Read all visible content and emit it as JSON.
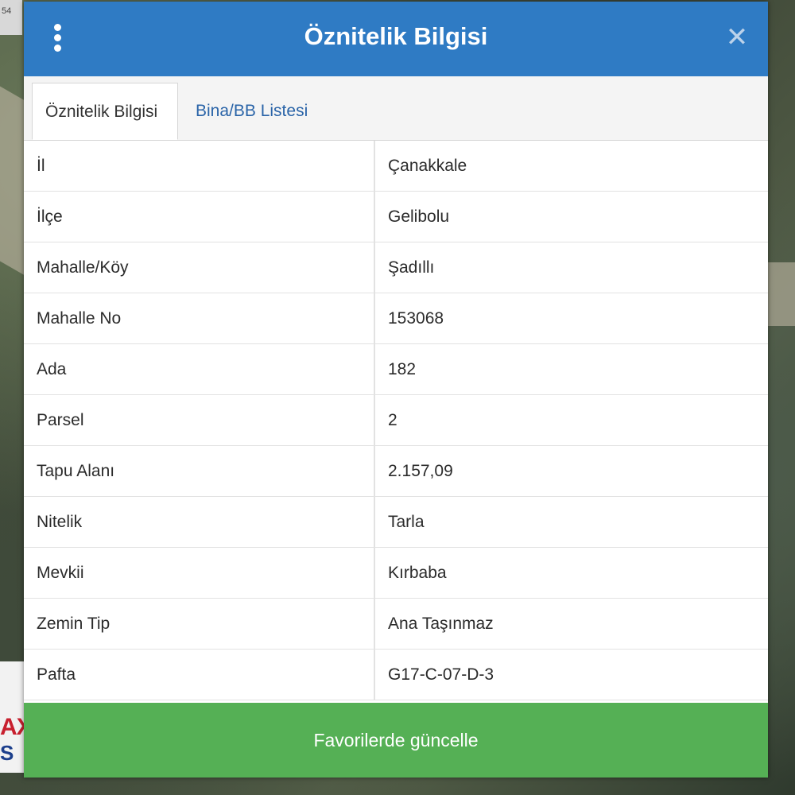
{
  "map": {
    "corner_text": "54"
  },
  "brand": {
    "text_top": "AX",
    "text_bottom": "S",
    "colors": {
      "red": "#c8202f",
      "blue": "#1c3f8c"
    }
  },
  "dialog": {
    "title": "Öznitelik Bilgisi",
    "header_color": "#2f7bc4",
    "menu_icon": "kebab-menu-icon",
    "close_icon": "close-icon",
    "close_glyph": "✕"
  },
  "tabs": [
    {
      "label": "Öznitelik Bilgisi",
      "active": true
    },
    {
      "label": "Bina/BB Listesi",
      "active": false
    }
  ],
  "attributes": [
    {
      "key": "İl",
      "value": "Çanakkale"
    },
    {
      "key": "İlçe",
      "value": "Gelibolu"
    },
    {
      "key": "Mahalle/Köy",
      "value": "Şadıllı"
    },
    {
      "key": "Mahalle No",
      "value": "153068"
    },
    {
      "key": "Ada",
      "value": "182"
    },
    {
      "key": "Parsel",
      "value": "2"
    },
    {
      "key": "Tapu Alanı",
      "value": "2.157,09"
    },
    {
      "key": "Nitelik",
      "value": "Tarla"
    },
    {
      "key": "Mevkii",
      "value": "Kırbaba"
    },
    {
      "key": "Zemin Tip",
      "value": "Ana Taşınmaz"
    },
    {
      "key": "Pafta",
      "value": "G17-C-07-D-3"
    }
  ],
  "footer": {
    "button_label": "Favorilerde güncelle",
    "button_color": "#55b055"
  }
}
